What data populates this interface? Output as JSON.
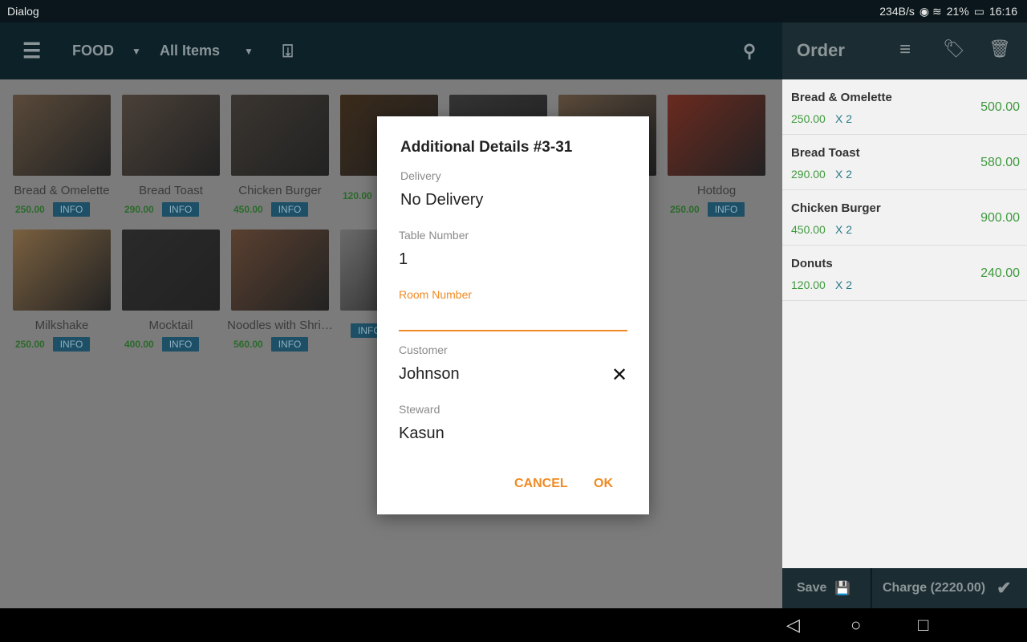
{
  "status": {
    "app": "Dialog",
    "speed": "234B/s",
    "battery": "21%",
    "time": "16:16"
  },
  "appbar": {
    "category": "FOOD",
    "filter": "All Items"
  },
  "items": [
    {
      "name": "Bread & Omelette",
      "price": "250.00",
      "info": "INFO",
      "color": "#5a4a3a"
    },
    {
      "name": "Bread Toast",
      "price": "290.00",
      "info": "INFO",
      "color": "#4a4038"
    },
    {
      "name": "Chicken Burger",
      "price": "450.00",
      "info": "INFO",
      "color": "#3a3530"
    },
    {
      "name": "",
      "price": "120.00",
      "info": "INFO",
      "color": "#3a2a1a"
    },
    {
      "name": "",
      "price": "",
      "info": "",
      "color": "#333"
    },
    {
      "name": "",
      "price": "",
      "info": "",
      "color": "#5a4a3a"
    },
    {
      "name": "Hotdog",
      "price": "250.00",
      "info": "INFO",
      "color": "#6a2a20"
    },
    {
      "name": "Milkshake",
      "price": "250.00",
      "info": "INFO",
      "color": "#7a6040"
    },
    {
      "name": "Mocktail",
      "price": "400.00",
      "info": "INFO",
      "color": "#2a2a2a"
    },
    {
      "name": "Noodles with Shri…",
      "price": "560.00",
      "info": "INFO",
      "color": "#5a4030"
    },
    {
      "name": "",
      "price": "",
      "info": "INFO",
      "color": "#6a6a6a"
    }
  ],
  "order": {
    "title": "Order",
    "items": [
      {
        "name": "Bread & Omelette",
        "price": "250.00",
        "qty": "X 2",
        "total": "500.00"
      },
      {
        "name": "Bread Toast",
        "price": "290.00",
        "qty": "X 2",
        "total": "580.00"
      },
      {
        "name": "Chicken Burger",
        "price": "450.00",
        "qty": "X 2",
        "total": "900.00"
      },
      {
        "name": "Donuts",
        "price": "120.00",
        "qty": "X 2",
        "total": "240.00"
      }
    ],
    "save": "Save",
    "charge": "Charge (2220.00)"
  },
  "dialog": {
    "title": "Additional Details #3-31",
    "delivery_label": "Delivery",
    "delivery": "No Delivery",
    "table_label": "Table Number",
    "table": "1",
    "room_label": "Room Number",
    "room": "",
    "customer_label": "Customer",
    "customer": "Johnson",
    "steward_label": "Steward",
    "steward": "Kasun",
    "cancel": "CANCEL",
    "ok": "OK"
  },
  "colors": {
    "accent": "#f08a24",
    "price_green": "#3f9a3f",
    "appbar": "#1b2c32"
  }
}
